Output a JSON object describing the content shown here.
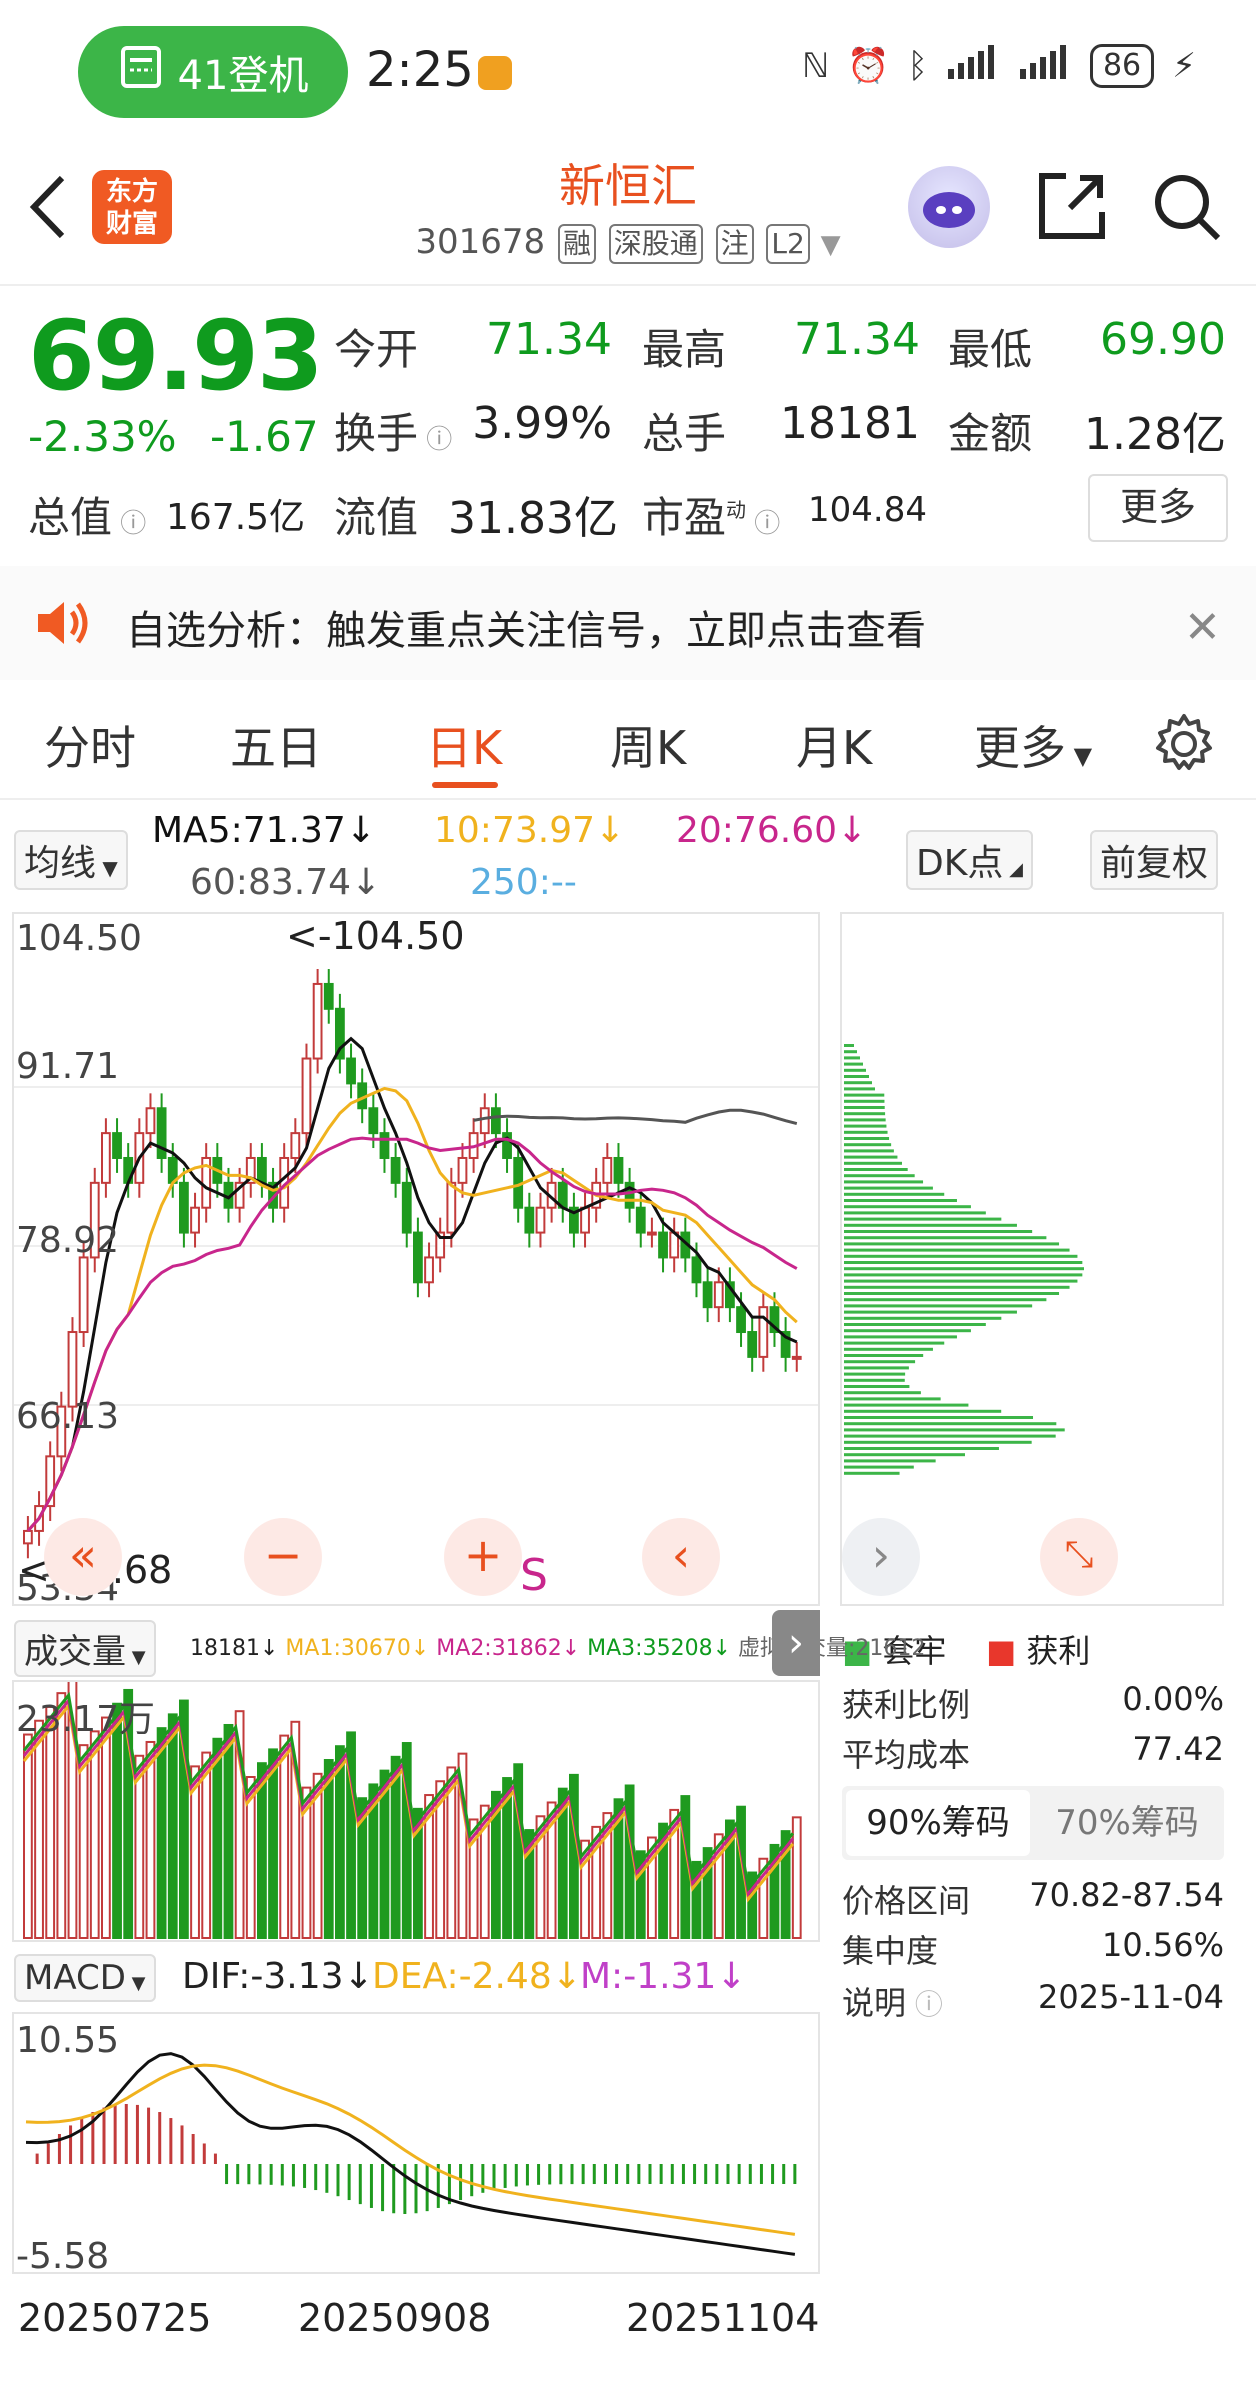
{
  "status_bar": {
    "pill_label": "41登机",
    "time": "2:25",
    "battery": "86"
  },
  "header": {
    "logo_line1": "东方",
    "logo_line2": "财富",
    "stock_name": "新恒汇",
    "stock_code": "301678",
    "tags": [
      "融",
      "深股通",
      "注",
      "L2"
    ]
  },
  "quote": {
    "price": "69.93",
    "change_pct": "-2.33%",
    "change_amt": "-1.67",
    "open_label": "今开",
    "open": "71.34",
    "high_label": "最高",
    "high": "71.34",
    "low_label": "最低",
    "low": "69.90",
    "turnover_label": "换手",
    "turnover": "3.99%",
    "volume_label": "总手",
    "volume": "18181",
    "amount_label": "金额",
    "amount": "1.28亿",
    "mktcap_label": "总值",
    "mktcap": "167.5亿",
    "float_label": "流值",
    "float_cap": "31.83亿",
    "pe_label": "市盈",
    "pe_sup": "动",
    "pe": "104.84",
    "more_label": "更多"
  },
  "notice": {
    "text": "自选分析：触发重点关注信号，立即点击查看"
  },
  "tabs": [
    "分时",
    "五日",
    "日K",
    "周K",
    "月K",
    "更多"
  ],
  "active_tab": "日K",
  "ma_bar": {
    "selector": "均线",
    "ma5": "MA5:71.37↓",
    "ma10": "10:73.97↓",
    "ma20": "20:76.60↓",
    "ma60": "60:83.74↓",
    "ma250": "250:--",
    "dk_label": "DK点",
    "adjust_label": "前复权",
    "colors": {
      "ma5": "#111111",
      "ma10": "#f0b21e",
      "ma20": "#c8268c",
      "ma60": "#555555",
      "ma250": "#5aaee0"
    }
  },
  "chart_data": {
    "type": "candlestick",
    "ylim": [
      53.34,
      104.5
    ],
    "y_ticks": [
      "104.50",
      "91.71",
      "78.92",
      "66.13",
      "53.34"
    ],
    "max_label": "<-104.50",
    "min_label": "<-54.68",
    "signal_label": "S",
    "x_labels": [
      "20250725",
      "20250908",
      "20251104"
    ],
    "closes": [
      56,
      58,
      62,
      66,
      72,
      78,
      84,
      88,
      86,
      84,
      88,
      90,
      86,
      84,
      80,
      82,
      86,
      84,
      82,
      84,
      86,
      84,
      82,
      86,
      88,
      94,
      100,
      98,
      94,
      92,
      90,
      88,
      86,
      84,
      80,
      76,
      78,
      80,
      84,
      86,
      88,
      90,
      88,
      86,
      82,
      80,
      82,
      84,
      82,
      80,
      82,
      84,
      86,
      84,
      82,
      80,
      80,
      78,
      80,
      78,
      76,
      74,
      76,
      74,
      72,
      70,
      74,
      72,
      70,
      70
    ]
  },
  "volume_panel": {
    "selector": "成交量",
    "vol": "18181↓",
    "ma1": "MA1:30670↓",
    "ma2": "MA2:31862↓",
    "ma3": "MA3:35208↓",
    "virtual": "虚拟成交量:21612",
    "top_label": "23.17万"
  },
  "macd_panel": {
    "selector": "MACD",
    "dif": "DIF:-3.13↓",
    "dea": "DEA:-2.48↓",
    "m": "M:-1.31↓",
    "top_label": "10.55",
    "bottom_label": "-5.58"
  },
  "chips": {
    "legend_trapped": "套牢",
    "legend_profit": "获利",
    "profit_ratio_label": "获利比例",
    "profit_ratio": "0.00%",
    "avg_cost_label": "平均成本",
    "avg_cost": "77.42",
    "tab_90": "90%筹码",
    "tab_70": "70%筹码",
    "range_label": "价格区间",
    "range": "70.82-87.54",
    "concentration_label": "集中度",
    "concentration": "10.56%",
    "note_label": "说明",
    "date": "2025-11-04"
  }
}
